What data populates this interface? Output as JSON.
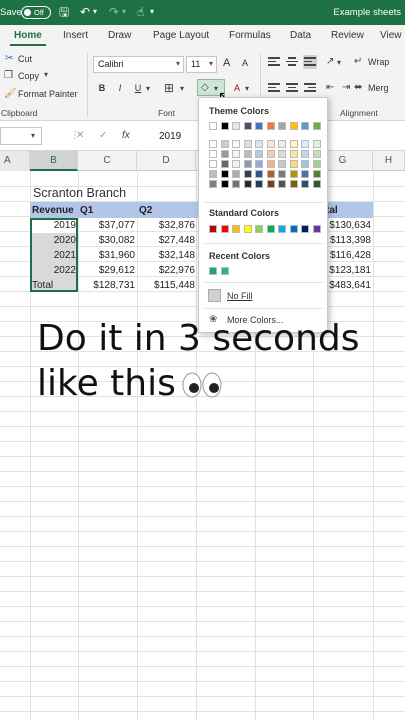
{
  "titlebar": {
    "save_label": "Save",
    "autosave_state": "Off",
    "filename": "Example sheets",
    "bg": "#1e7145"
  },
  "tabs": [
    "Home",
    "Insert",
    "Draw",
    "Page Layout",
    "Formulas",
    "Data",
    "Review",
    "View"
  ],
  "active_tab": "Home",
  "ribbon": {
    "cut": "Cut",
    "copy": "Copy",
    "format_painter": "Format Painter",
    "clipboard_label": "Clipboard",
    "font_name": "Calibri",
    "font_size": "11",
    "font_label": "Font",
    "alignment_label": "Alignment",
    "wrap": "Wrap",
    "merge": "Merg",
    "bold": "B",
    "italic": "I",
    "underline": "U",
    "grow": "A",
    "shrink": "A",
    "font_color": "A"
  },
  "formula": {
    "value": "2019"
  },
  "columns": [
    "A",
    "B",
    "C",
    "D",
    "G",
    "H"
  ],
  "sheet": {
    "title": "Scranton Branch",
    "headers": [
      "Revenue",
      "Q1",
      "Q2",
      "tal"
    ],
    "rows": [
      {
        "label": "2019",
        "q1": "$37,077",
        "q2": "$32,876",
        "total": "$130,634"
      },
      {
        "label": "2020",
        "q1": "$30,082",
        "q2": "$27,448",
        "total": "$113,398"
      },
      {
        "label": "2021",
        "q1": "$31,960",
        "q2": "$32,148",
        "total": "$116,428"
      },
      {
        "label": "2022",
        "q1": "$29,612",
        "q2": "$22,976",
        "total": "$123,181"
      }
    ],
    "total_row": {
      "label": "Total",
      "q1": "$128,731",
      "q2": "$115,448",
      "total": "$483,641"
    }
  },
  "dropdown": {
    "theme_title": "Theme Colors",
    "standard_title": "Standard Colors",
    "recent_title": "Recent Colors",
    "no_fill": "No Fill",
    "more_colors": "More Colors...",
    "theme_colors": [
      "#ffffff",
      "#000000",
      "#e7e6e6",
      "#44546a",
      "#4472c4",
      "#ed7d31",
      "#a5a5a5",
      "#ffc000",
      "#5b9bd5",
      "#70ad47"
    ],
    "standard_colors": [
      "#c00000",
      "#ff0000",
      "#ffc000",
      "#ffff00",
      "#92d050",
      "#00b050",
      "#00b0f0",
      "#0070c0",
      "#002060",
      "#7030a0"
    ],
    "recent_colors": [
      "#1fa37a",
      "#2fb58a"
    ]
  },
  "caption": {
    "line1": "Do it in 3 seconds",
    "line2": "like this"
  }
}
